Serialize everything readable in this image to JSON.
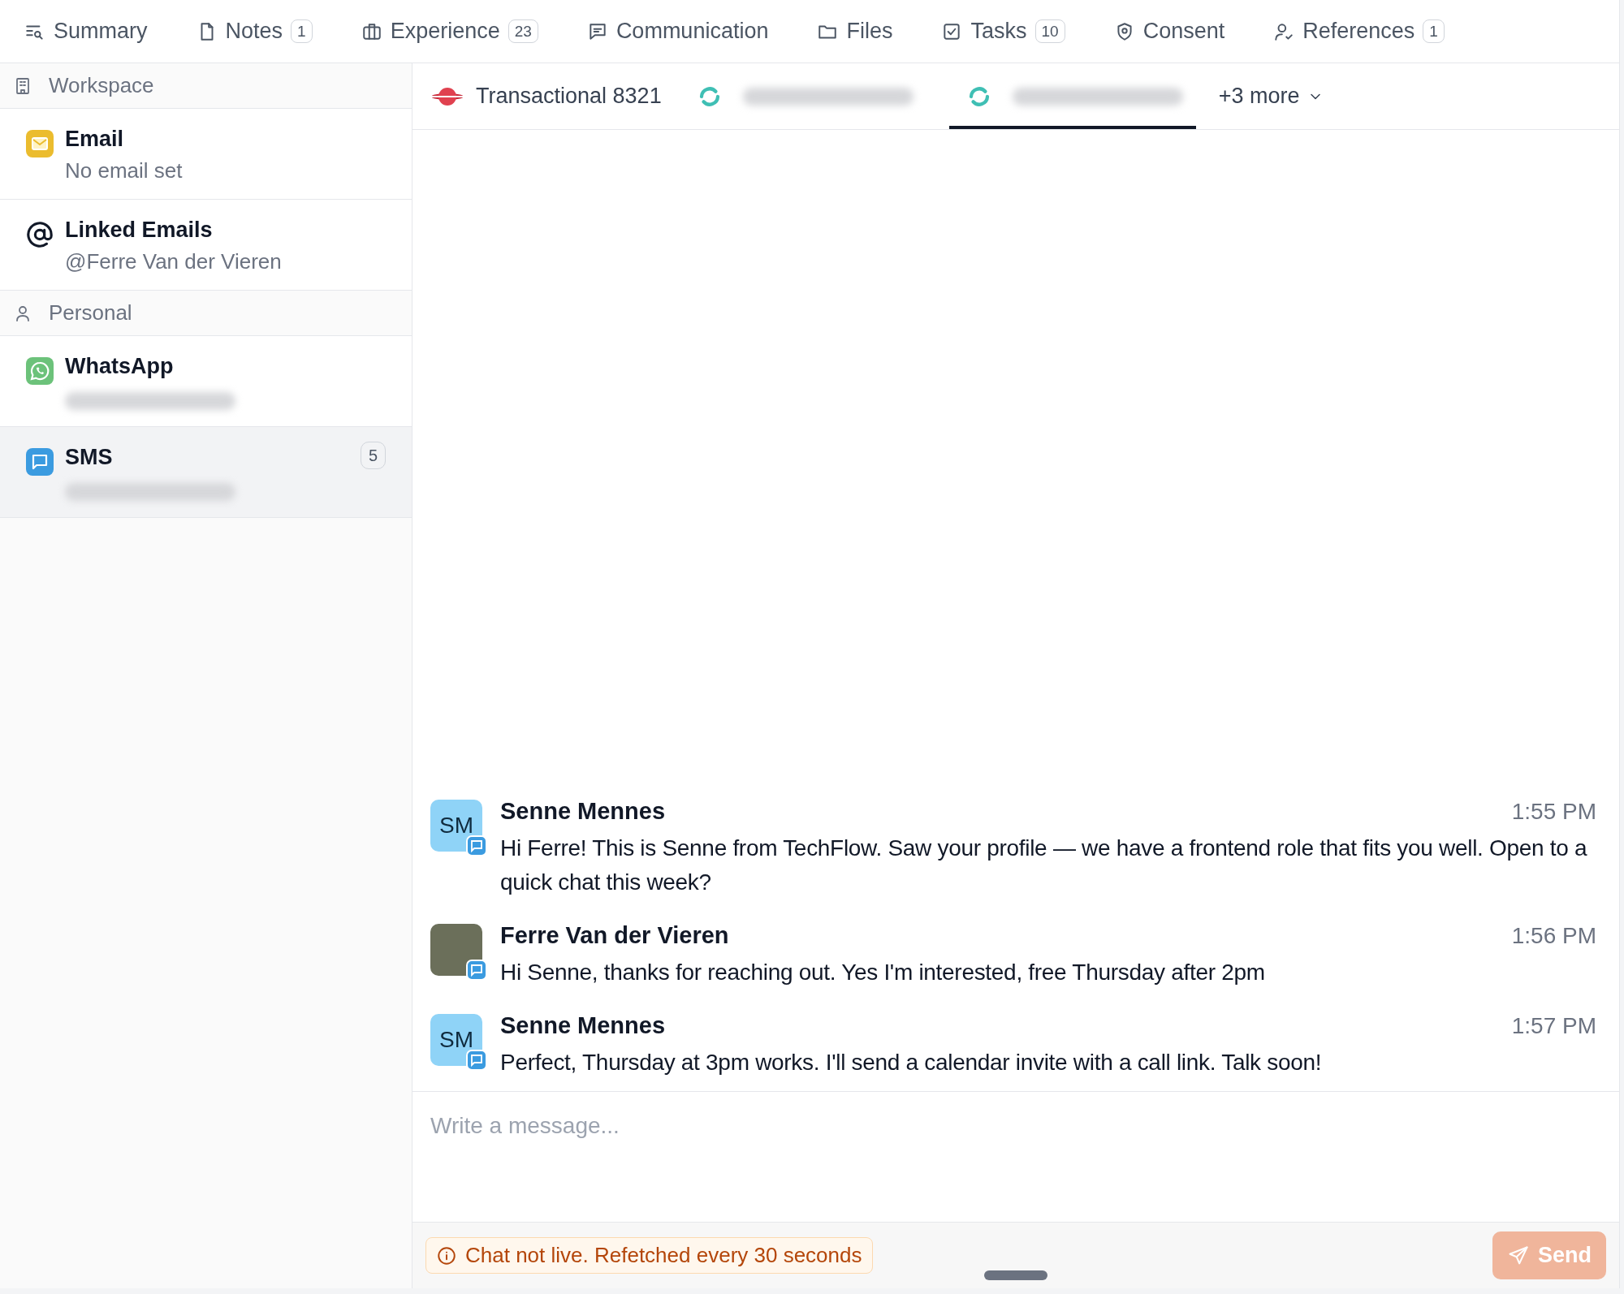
{
  "top_tabs": [
    {
      "label": "Summary"
    },
    {
      "label": "Notes",
      "count": "1"
    },
    {
      "label": "Experience",
      "count": "23"
    },
    {
      "label": "Communication"
    },
    {
      "label": "Files"
    },
    {
      "label": "Tasks",
      "count": "10"
    },
    {
      "label": "Consent"
    },
    {
      "label": "References",
      "count": "1"
    }
  ],
  "sidebar": {
    "sections": [
      {
        "title": "Workspace",
        "items": [
          {
            "kind": "email",
            "title": "Email",
            "subtitle": "No email set",
            "redacted": false,
            "selected": false
          },
          {
            "kind": "linked",
            "title": "Linked Emails",
            "subtitle": "@Ferre Van der Vieren",
            "redacted": false,
            "selected": false
          }
        ]
      },
      {
        "title": "Personal",
        "items": [
          {
            "kind": "whatsapp",
            "title": "WhatsApp",
            "redacted": true,
            "selected": false
          },
          {
            "kind": "sms",
            "title": "SMS",
            "count": "5",
            "redacted": true,
            "selected": true
          }
        ]
      }
    ]
  },
  "channel_tabs": {
    "tabs": [
      {
        "kind": "transactional",
        "label": "Transactional 8321",
        "redacted": false,
        "selected": false
      },
      {
        "kind": "number",
        "redacted": true,
        "selected": false
      },
      {
        "kind": "number",
        "redacted": true,
        "selected": true
      }
    ],
    "more": "+3 more"
  },
  "messages": [
    {
      "kind": "initials",
      "initials": "SM",
      "sender": "Senne Mennes",
      "time": "1:55 PM",
      "text": "Hi Ferre! This is Senne from TechFlow. Saw your profile — we have a frontend role that fits you well. Open to a quick chat this week?"
    },
    {
      "kind": "photo",
      "sender": "Ferre Van der Vieren",
      "time": "1:56 PM",
      "text": "Hi Senne, thanks for reaching out. Yes I'm interested, free Thursday after 2pm"
    },
    {
      "kind": "initials",
      "initials": "SM",
      "sender": "Senne Mennes",
      "time": "1:57 PM",
      "text": "Perfect, Thursday at 3pm works. I'll send a calendar invite with a call link. Talk soon!"
    }
  ],
  "composer": {
    "placeholder": "Write a message...",
    "notice": "Chat not live. Refetched every 30 seconds",
    "send": {
      "label": "Send",
      "disabled": true
    }
  }
}
